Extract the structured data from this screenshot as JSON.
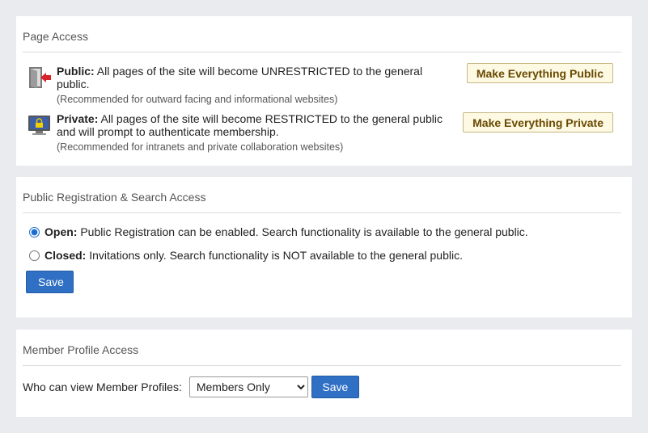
{
  "page_access": {
    "title": "Page Access",
    "public": {
      "label": "Public:",
      "text": " All pages of the site will become UNRESTRICTED to the general public.",
      "note": "(Recommended for outward facing and informational websites)",
      "button": "Make Everything Public",
      "icon": "door-exit-icon"
    },
    "private": {
      "label": "Private:",
      "text": " All pages of the site will become RESTRICTED to the general public and will prompt to authenticate membership.",
      "note": "(Recommended for intranets and private collaboration websites)",
      "button": "Make Everything Private",
      "icon": "locked-monitor-icon"
    }
  },
  "registration": {
    "title": "Public Registration & Search Access",
    "open": {
      "label": "Open:",
      "text": " Public Registration can be enabled. Search functionality is available to the general public.",
      "checked": true
    },
    "closed": {
      "label": "Closed:",
      "text": " Invitations only. Search functionality is NOT available to the general public.",
      "checked": false
    },
    "save": "Save"
  },
  "member_profile": {
    "title": "Member Profile Access",
    "label": "Who can view Member Profiles:",
    "selected": "Members Only",
    "save": "Save"
  },
  "colors": {
    "accent_blue": "#2f6fc4",
    "gold_button_bg": "#fdf9e3",
    "gold_button_text": "#6a4a00",
    "page_bg": "#e9ebef"
  }
}
